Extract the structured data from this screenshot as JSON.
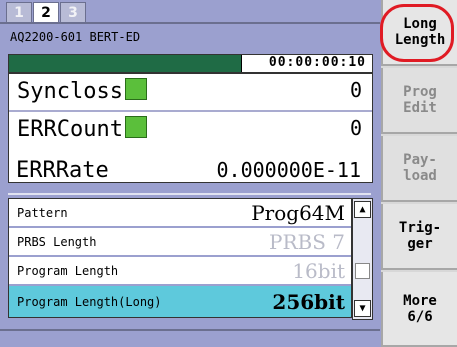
{
  "tabs": [
    "1",
    "2",
    "3"
  ],
  "active_tab_index": 1,
  "model": "AQ2200-601 BERT-ED",
  "elapsed_time": "00:00:00:10",
  "progress_fraction": 0.64,
  "measurements": {
    "syncloss": {
      "label": "Syncloss",
      "value": "0"
    },
    "errcount": {
      "label": "ERRCount",
      "value": "0"
    },
    "errrate": {
      "label": "ERRRate",
      "value": "0.000000E-11"
    }
  },
  "settings": [
    {
      "label": "Pattern",
      "value": "Prog64M",
      "dim": false,
      "selected": false
    },
    {
      "label": "PRBS Length",
      "value": "PRBS 7",
      "dim": true,
      "selected": false
    },
    {
      "label": "Program Length",
      "value": "16bit",
      "dim": true,
      "selected": false
    },
    {
      "label": "Program Length(Long)",
      "value": "256bit",
      "dim": false,
      "selected": true
    }
  ],
  "softkeys": [
    {
      "label": "Long\nLength",
      "enabled": true
    },
    {
      "label": "Prog\nEdit",
      "enabled": false
    },
    {
      "label": "Pay-\nload",
      "enabled": false
    },
    {
      "label": "Trig-\nger",
      "enabled": true
    },
    {
      "label": "More\n6/6",
      "enabled": true
    }
  ],
  "colors": {
    "panel": "#9ba0cf",
    "indicator_green": "#5bbf3b",
    "selected_row": "#5ec9dc",
    "highlight_ring": "#e01b24"
  }
}
